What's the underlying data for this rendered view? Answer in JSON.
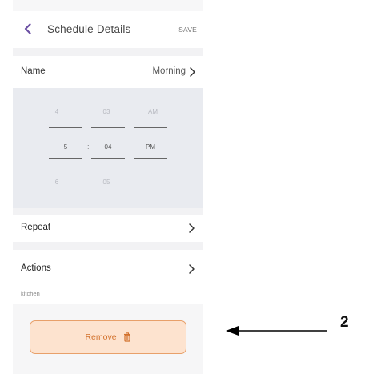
{
  "header": {
    "title": "Schedule Details",
    "save_label": "SAVE"
  },
  "name_row": {
    "label": "Name",
    "value": "Morning"
  },
  "time_picker": {
    "hour": {
      "above": "4",
      "selected": "5",
      "below": "6"
    },
    "minute": {
      "above": "03",
      "selected": "04",
      "below": "05"
    },
    "ampm": {
      "above": "AM",
      "selected": "PM"
    },
    "separator": ":"
  },
  "repeat_row": {
    "label": "Repeat"
  },
  "actions_row": {
    "label": "Actions",
    "subtitle": "kitchen"
  },
  "remove_button": {
    "label": "Remove"
  },
  "annotation": {
    "label": "2"
  },
  "colors": {
    "accent": "#6b4fa3",
    "remove_bg": "#fde3cf",
    "remove_border": "#e8a06a",
    "remove_text": "#d2712c"
  }
}
